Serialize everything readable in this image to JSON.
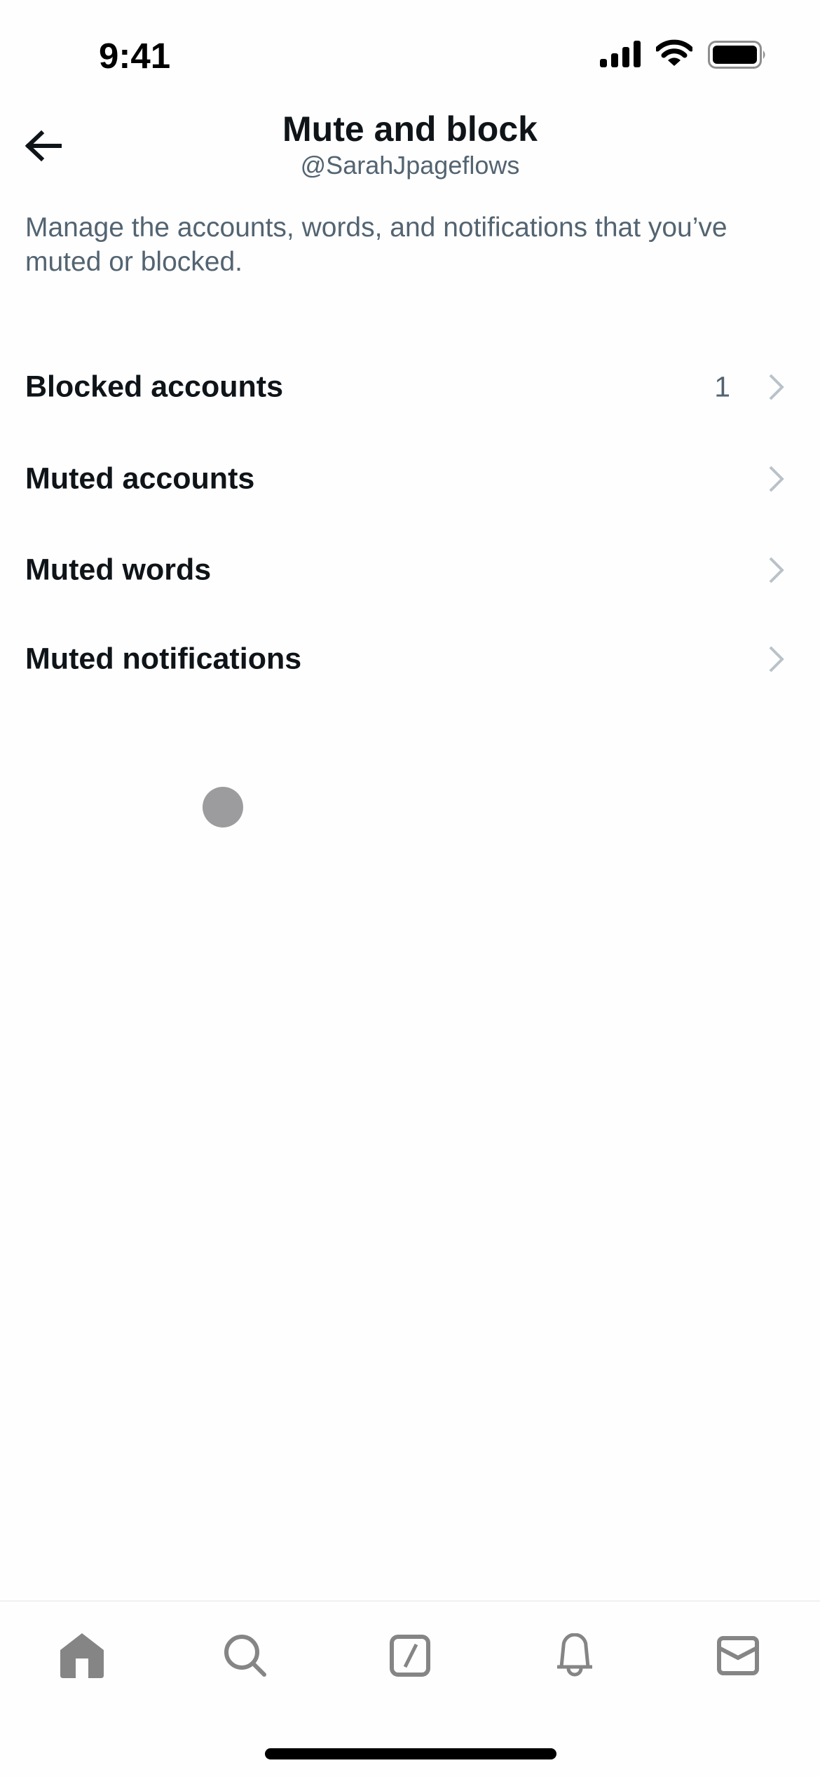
{
  "status_bar": {
    "time": "9:41",
    "icons": [
      "cellular-signal-icon",
      "wifi-icon",
      "battery-icon"
    ]
  },
  "header": {
    "back_icon": "arrow-left-icon",
    "title": "Mute and block",
    "subtitle": "@SarahJpageflows"
  },
  "description": "Manage the accounts, words, and notifications that you’ve muted or blocked.",
  "settings_list": [
    {
      "label": "Blocked accounts",
      "count": "1",
      "icon": "chevron-right-icon"
    },
    {
      "label": "Muted accounts",
      "count": "",
      "icon": "chevron-right-icon"
    },
    {
      "label": "Muted words",
      "count": "",
      "icon": "chevron-right-icon"
    },
    {
      "label": "Muted notifications",
      "count": "",
      "icon": "chevron-right-icon"
    }
  ],
  "tab_bar": {
    "tabs": [
      {
        "name": "home",
        "icon": "home-icon",
        "active": true
      },
      {
        "name": "search",
        "icon": "search-icon",
        "active": false
      },
      {
        "name": "grok",
        "icon": "grok-icon",
        "active": false
      },
      {
        "name": "notifications",
        "icon": "bell-icon",
        "active": false
      },
      {
        "name": "messages",
        "icon": "mail-icon",
        "active": false
      }
    ]
  },
  "colors": {
    "text_primary": "#0f1419",
    "text_secondary": "#536471",
    "chevron": "#b9c2c9",
    "tab_icon": "#858586",
    "touch_indicator": "#9c9b9e"
  }
}
